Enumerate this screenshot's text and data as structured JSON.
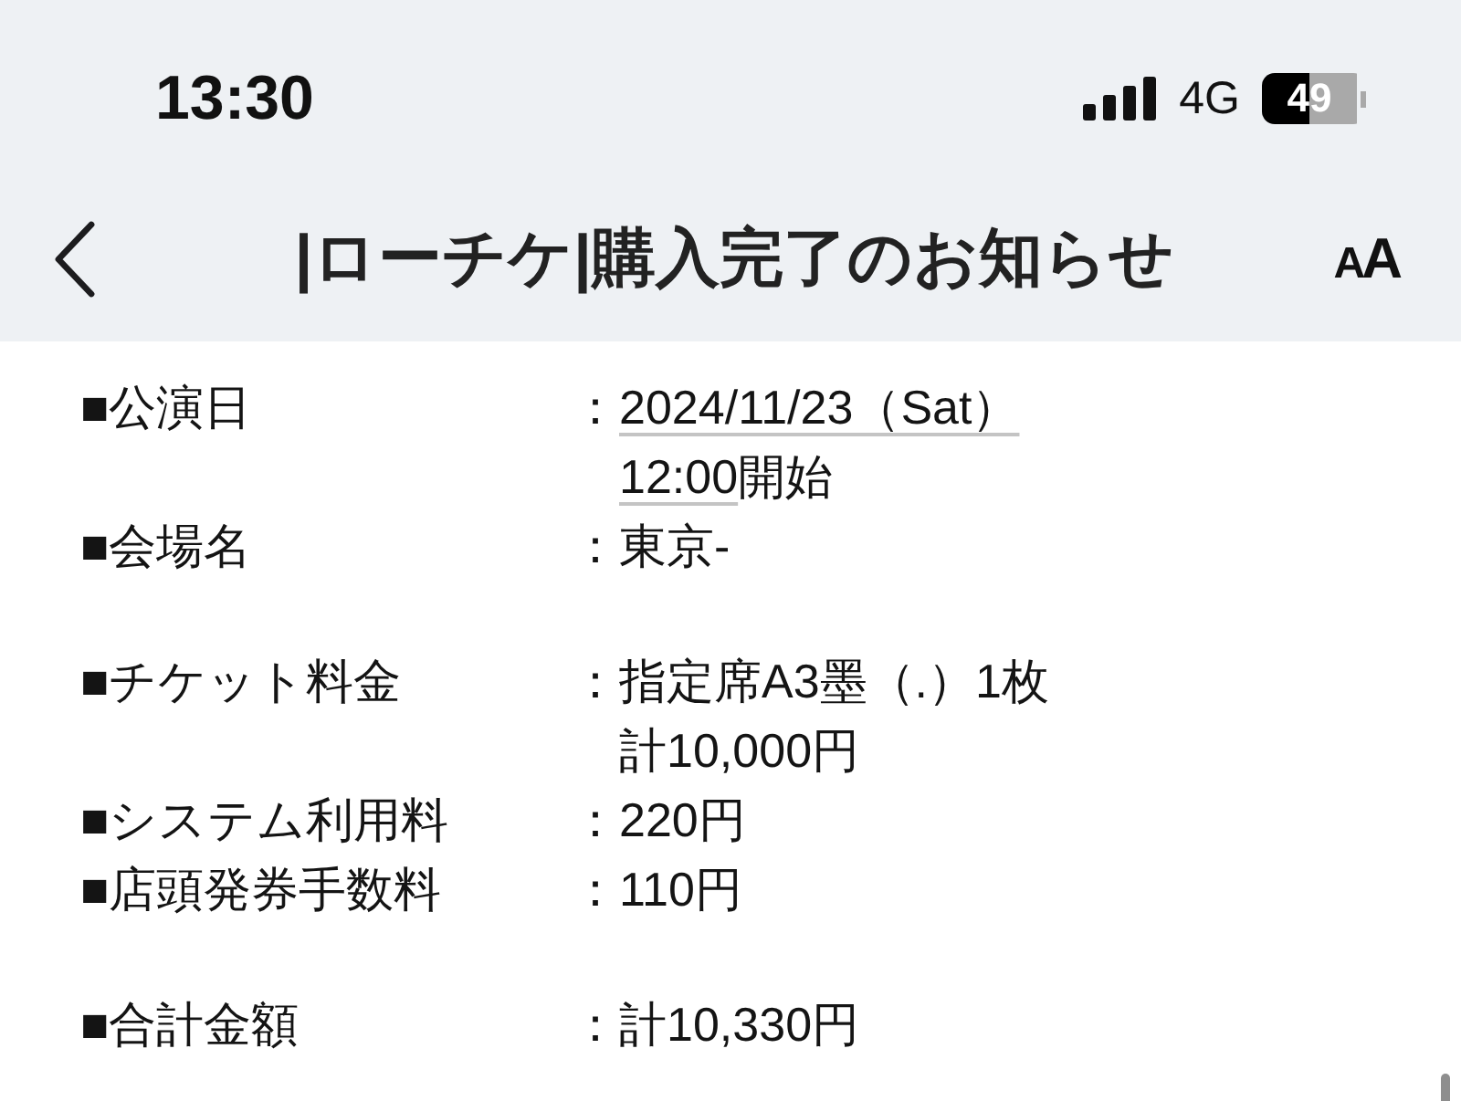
{
  "status_bar": {
    "time": "13:30",
    "network": "4G",
    "battery": "49"
  },
  "nav_bar": {
    "title": "|ローチケ|購入完了のお知らせ",
    "text_size_button": "AA"
  },
  "sections": [
    {
      "rows": [
        {
          "label": "■公演日",
          "colon": "：",
          "lines": [
            [
              {
                "text": "2024/11/23（Sat）",
                "link": true
              }
            ],
            [
              {
                "text": "12:00",
                "link": true
              },
              {
                "text": "開始",
                "link": false
              }
            ]
          ]
        },
        {
          "label": "■会場名",
          "colon": "：",
          "lines": [
            [
              {
                "text": "東京-",
                "link": false
              }
            ]
          ]
        }
      ]
    },
    {
      "rows": [
        {
          "label": "■チケット料金",
          "colon": "：",
          "lines": [
            [
              {
                "text": "指定席A3墨（.）1枚",
                "link": false
              }
            ],
            [
              {
                "text": "計10,000円",
                "link": false
              }
            ]
          ]
        },
        {
          "label": "■システム利用料",
          "colon": "：",
          "lines": [
            [
              {
                "text": "220円",
                "link": false
              }
            ]
          ]
        },
        {
          "label": "■店頭発券手数料",
          "colon": "：",
          "lines": [
            [
              {
                "text": "110円",
                "link": false
              }
            ]
          ]
        }
      ]
    },
    {
      "rows": [
        {
          "label": "■合計金額",
          "colon": "：",
          "lines": [
            [
              {
                "text": "計10,330円",
                "link": false
              }
            ]
          ]
        }
      ]
    }
  ]
}
